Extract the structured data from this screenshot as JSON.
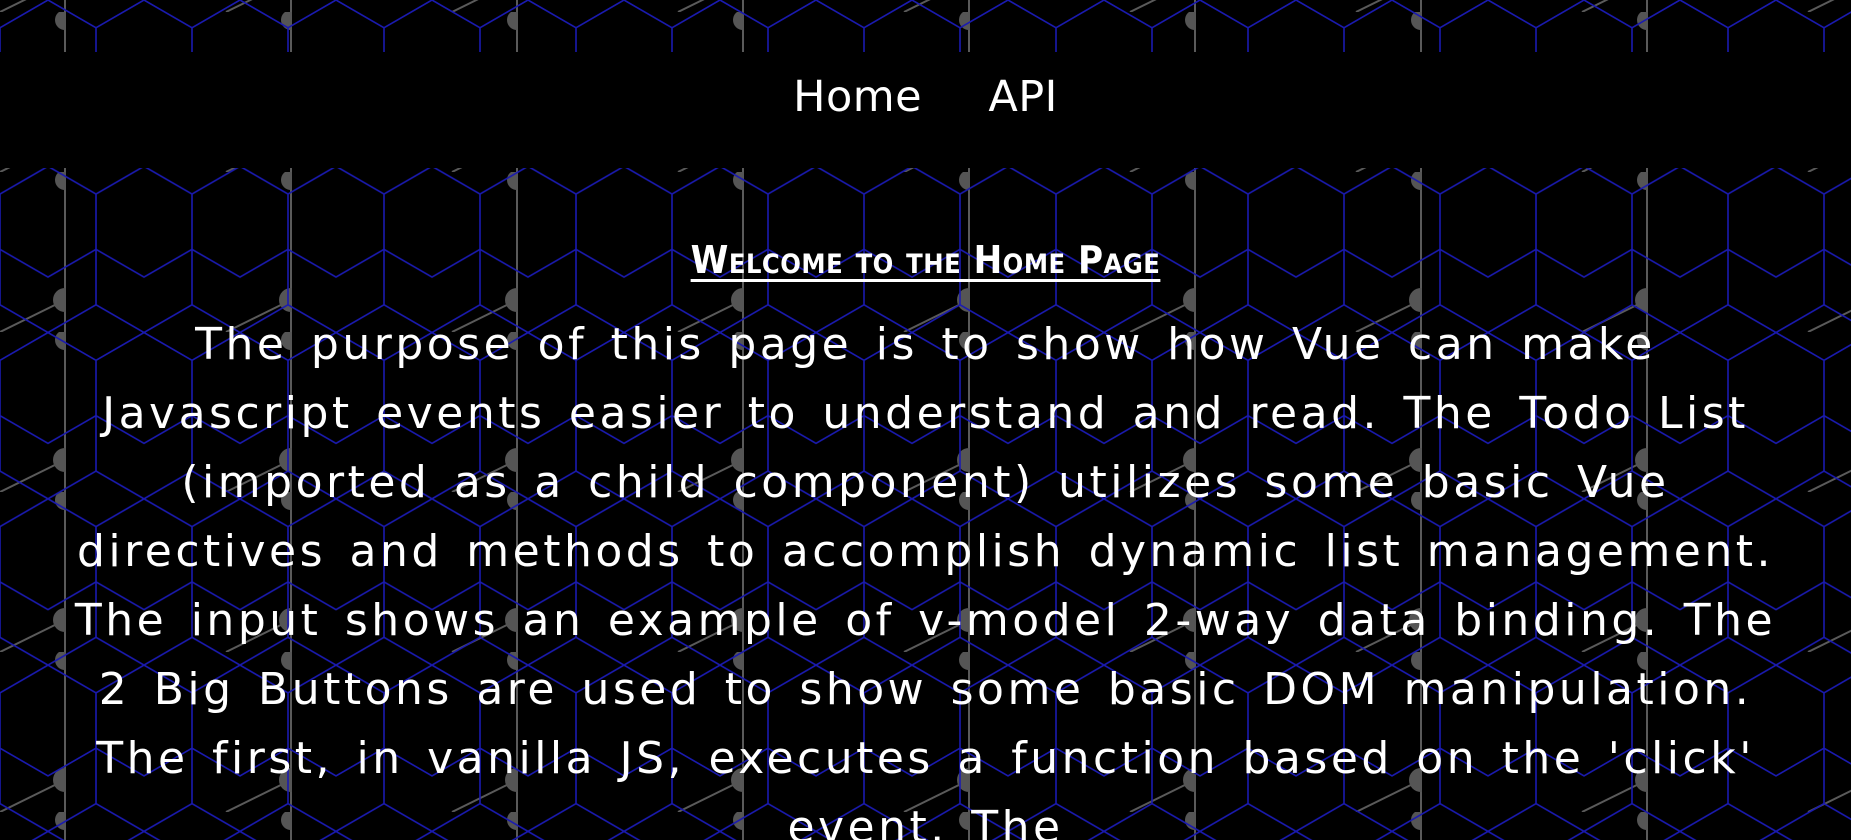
{
  "nav": {
    "items": [
      {
        "label": "Home"
      },
      {
        "label": "API"
      }
    ]
  },
  "main": {
    "title": "Welcome to the Home Page",
    "description": "The purpose of this page is to show how Vue can make Javascript events easier to understand and read. The Todo List (imported as a child component) utilizes some basic Vue directives and methods to accomplish dynamic list management. The input shows an example of v-model 2-way data binding. The 2 Big Buttons are used to show some basic DOM manipulation. The first, in vanilla JS, executes a function based on the 'click' event. The"
  },
  "colors": {
    "background": "#000000",
    "hex_grid": "#1a1ab0",
    "connector": "#555555",
    "text": "#ffffff"
  }
}
